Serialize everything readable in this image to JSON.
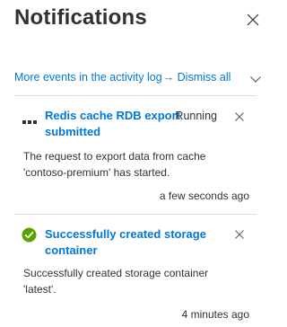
{
  "panel": {
    "title": "Notifications",
    "close_icon": "close-icon"
  },
  "toolbar": {
    "activity_log_link": "More events in the activity log",
    "arrow": "→",
    "dismiss_all": "Dismiss all",
    "expand_icon": "chevron-down-icon"
  },
  "notifications": [
    {
      "status_icon": "in-progress-dots-icon",
      "title_line1": "Redis cache RDB export",
      "title_line2": "submitted",
      "state": "Running",
      "body_line1": "The request to export data from cache",
      "body_line2": "'contoso-premium' has started.",
      "time": "a few seconds ago"
    },
    {
      "status_icon": "success-check-icon",
      "status_color": "#57a300",
      "title_line1": "Successfully created storage",
      "title_line2": "container",
      "state": "",
      "body_line1": "Successfully created storage container",
      "body_line2": "'latest'.",
      "time": "4 minutes ago"
    }
  ],
  "colors": {
    "link": "#0078d4",
    "text": "#323130",
    "divider": "#e1dfdd",
    "success": "#57a300"
  }
}
